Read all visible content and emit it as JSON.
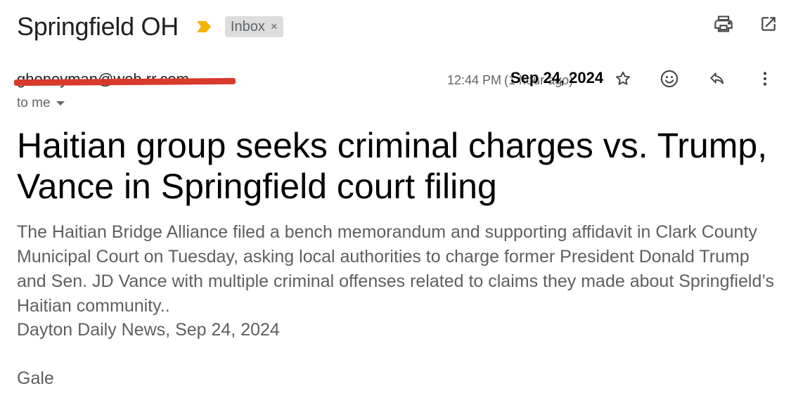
{
  "subject": {
    "title": "Springfield OH",
    "label": "Inbox",
    "label_remove": "×",
    "importance_color": "#f4b400"
  },
  "toolbar": {
    "print_icon": "print-icon",
    "open_new_window_icon": "open-in-new-window-icon"
  },
  "message": {
    "sender": "ghoneyman@woh.rr.com",
    "sender_redacted": true,
    "redaction_color": "#d83a2c",
    "time": "12:44 PM",
    "ago": "(1 hour ago)",
    "date_overlay": "Sep 24, 2024",
    "recipient": "to me",
    "actions": {
      "star_icon": "star-icon",
      "emoji_icon": "emoji-reaction-icon",
      "reply_icon": "reply-icon",
      "more_icon": "more-options-icon"
    }
  },
  "body": {
    "headline": "Haitian group seeks criminal charges vs. Trump, Vance in Springfield court filing",
    "summary": "The Haitian Bridge Alliance filed a bench memorandum and supporting affidavit in Clark County Municipal Court on Tuesday, asking local authorities to charge former President Donald Trump and Sen. JD Vance with multiple criminal offenses related to claims they made about Springfield’s Haitian community..",
    "source": "Dayton Daily News, Sep 24, 2024",
    "signature": "Gale"
  }
}
